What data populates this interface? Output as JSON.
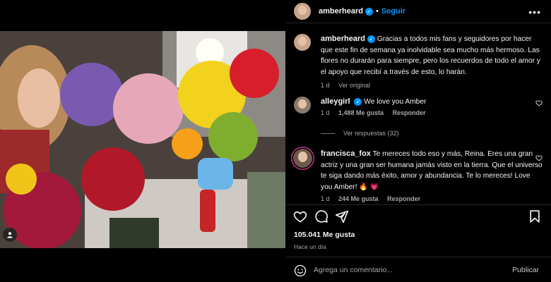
{
  "post": {
    "username": "amberheard",
    "follow_label": "Seguir",
    "more_glyph": "•••",
    "separator": "•"
  },
  "caption": {
    "username": "amberheard",
    "text": "Gracias a todos mis fans y seguidores por hacer que este fin de semana ya inolvidable sea mucho más hermoso. Las flores no durarán para siempre, pero los recuerdos de todo el amor y el apoyo que recibí a través de esto, lo harán.",
    "time": "1 d",
    "translate_label": "Ver original"
  },
  "comments": [
    {
      "username": "alleygirl",
      "text": "We love you Amber",
      "time": "1 d",
      "likes": "1,488 Me gusta",
      "reply_label": "Responder",
      "view_replies": "Ver respuestas (32)"
    },
    {
      "username": "francisca_fox",
      "text": "Te mereces todo eso y más, Reina. Eres una gran actriz y una gran ser humana jamás visto en la tierra. Que el universo te siga dando más éxito, amor y abundancia. Te lo mereces! Love you Amber! 🔥 💗",
      "time": "1 d",
      "likes": "244 Me gusta",
      "reply_label": "Responder"
    }
  ],
  "footer": {
    "likes": "105.041 Me gusta",
    "posted": "Hace un día"
  },
  "composer": {
    "placeholder": "Agrega un comentario...",
    "publish_label": "Publicar"
  },
  "icons": {
    "verified": "verified-badge-icon",
    "heart": "heart-icon",
    "comment": "comment-icon",
    "share": "paper-plane-icon",
    "save": "bookmark-icon",
    "emoji": "smiley-icon",
    "tag": "user-tag-icon"
  },
  "colors": {
    "accent": "#0095f6",
    "background": "#000000",
    "secondary_text": "#a8a8a8",
    "divider": "#262626"
  }
}
